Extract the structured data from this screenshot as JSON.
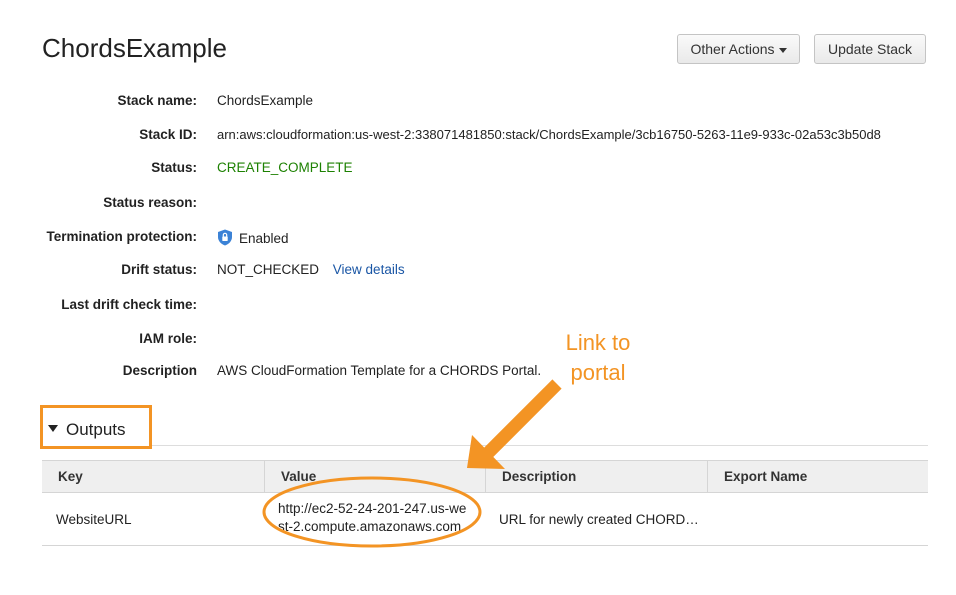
{
  "header": {
    "title": "ChordsExample",
    "other_actions_label": "Other Actions",
    "update_stack_label": "Update Stack"
  },
  "details": [
    {
      "label": "Stack name:",
      "value": "ChordsExample"
    },
    {
      "label": "Stack ID:",
      "value": "arn:aws:cloudformation:us-west-2:338071481850:stack/ChordsExample/3cb16750-5263-11e9-933c-02a53c3b50d8"
    },
    {
      "label": "Status:",
      "value": "CREATE_COMPLETE"
    },
    {
      "label": "Status reason:",
      "value": ""
    },
    {
      "label": "Termination protection:",
      "value": "Enabled"
    },
    {
      "label": "Drift status:",
      "value": "NOT_CHECKED",
      "link": "View details"
    },
    {
      "label": "Last drift check time:",
      "value": ""
    },
    {
      "label": "IAM role:",
      "value": ""
    },
    {
      "label": "Description",
      "value": "AWS CloudFormation Template for a CHORDS Portal."
    }
  ],
  "outputs": {
    "header": "Outputs",
    "columns": [
      "Key",
      "Value",
      "Description",
      "Export Name"
    ],
    "rows": [
      {
        "key": "WebsiteURL",
        "value_line1": "http://ec2-52-24-201-247.us-we",
        "value_line2": "st-2.compute.amazonaws.com",
        "description": "URL for newly created CHORD…",
        "export_name": ""
      }
    ]
  },
  "annotation": {
    "line1": "Link to",
    "line2": "portal",
    "color": "#f39424"
  },
  "colors": {
    "status_green": "#1d8102",
    "link_blue": "#1a56a5",
    "shield_blue": "#3b82d6"
  }
}
